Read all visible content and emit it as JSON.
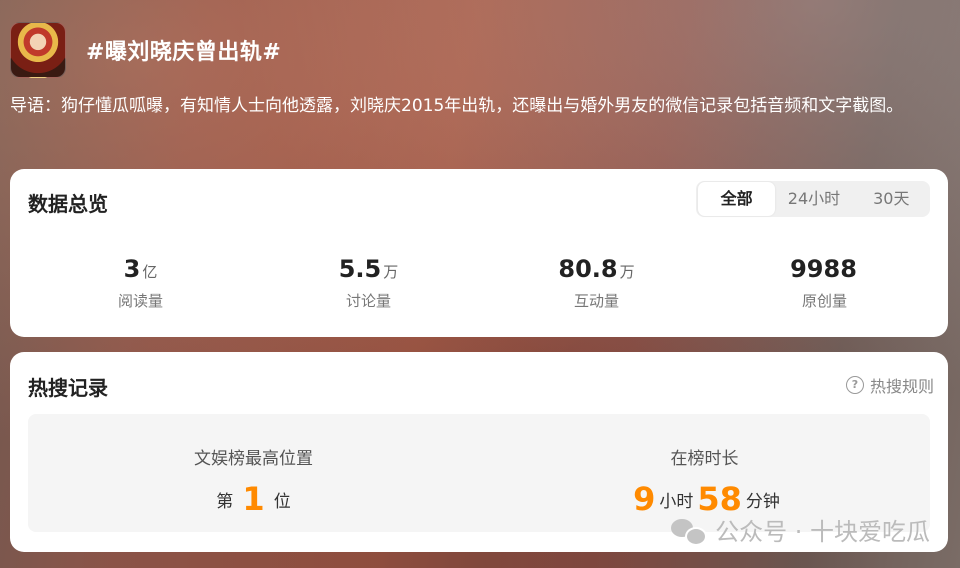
{
  "topic": {
    "title": "#曝刘晓庆曾出轨#",
    "intro": "导语：狗仔懂瓜呱曝，有知情人士向他透露，刘晓庆2015年出轨，还曝出与婚外男友的微信记录包括音频和文字截图。"
  },
  "overview": {
    "title": "数据总览",
    "tabs": [
      {
        "label": "全部",
        "active": true
      },
      {
        "label": "24小时",
        "active": false
      },
      {
        "label": "30天",
        "active": false
      }
    ],
    "stats": [
      {
        "value": "3",
        "unit": "亿",
        "label": "阅读量"
      },
      {
        "value": "5.5",
        "unit": "万",
        "label": "讨论量"
      },
      {
        "value": "80.8",
        "unit": "万",
        "label": "互动量"
      },
      {
        "value": "9988",
        "unit": "",
        "label": "原创量"
      }
    ]
  },
  "hot_search": {
    "title": "热搜记录",
    "rules_label": "热搜规则",
    "best_position": {
      "label": "文娱榜最高位置",
      "prefix": "第",
      "value": "1",
      "suffix": "位"
    },
    "duration": {
      "label": "在榜时长",
      "hours": "9",
      "hours_unit": "小时",
      "minutes": "58",
      "minutes_unit": "分钟"
    }
  },
  "watermark": {
    "text": "公众号 · 十块爱吃瓜",
    "icon": "wechat-icon"
  },
  "colors": {
    "accent_orange": "#ff8a00",
    "card_bg": "#ffffff",
    "muted_text": "#777777"
  }
}
